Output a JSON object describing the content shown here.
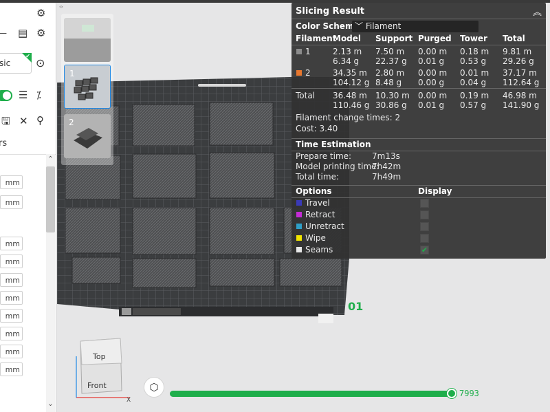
{
  "sidebar": {
    "combo_value": "sic",
    "label": "rs",
    "unit": "mm",
    "unit_rows": 10
  },
  "viewport": {
    "plates": [
      {
        "number": ""
      },
      {
        "number": "1"
      },
      {
        "number": "2"
      }
    ],
    "object_label": "01",
    "navcube": {
      "top": "Top",
      "front": "Front"
    },
    "slider": {
      "value": "7993",
      "progress": 1.0
    }
  },
  "slicing_result": {
    "title": "Slicing Result",
    "color_scheme_label": "Color Scheme",
    "color_scheme_value": "Filament",
    "headers": [
      "Filament",
      "Model",
      "Support",
      "Purged",
      "Tower",
      "Total"
    ],
    "filaments": [
      {
        "id": "1",
        "color": "#8c8c8c",
        "model": [
          "2.13 m",
          "6.34 g"
        ],
        "support": [
          "7.50 m",
          "22.37 g"
        ],
        "purged": [
          "0.00 m",
          "0.01 g"
        ],
        "tower": [
          "0.18 m",
          "0.53 g"
        ],
        "total": [
          "9.81 m",
          "29.26 g"
        ]
      },
      {
        "id": "2",
        "color": "#e8772e",
        "model": [
          "34.35 m",
          "104.12 g"
        ],
        "support": [
          "2.80 m",
          "8.48 g"
        ],
        "purged": [
          "0.00 m",
          "0.00 g"
        ],
        "tower": [
          "0.01 m",
          "0.04 g"
        ],
        "total": [
          "37.17 m",
          "112.64 g"
        ]
      }
    ],
    "total_row": {
      "label": "Total",
      "model": [
        "36.48 m",
        "110.46 g"
      ],
      "support": [
        "10.30 m",
        "30.86 g"
      ],
      "purged": [
        "0.00 m",
        "0.01 g"
      ],
      "tower": [
        "0.19 m",
        "0.57 g"
      ],
      "total": [
        "46.98 m",
        "141.90 g"
      ]
    },
    "filament_change": "Filament change times: 2",
    "cost": "Cost: 3.40",
    "time_title": "Time Estimation",
    "times": [
      {
        "label": "Prepare time:",
        "value": "7m13s"
      },
      {
        "label": "Model printing time:",
        "value": "7h42m"
      },
      {
        "label": "Total time:",
        "value": "7h49m"
      }
    ],
    "options_header": "Options",
    "display_header": "Display",
    "options": [
      {
        "label": "Travel",
        "color": "#3a3ab8",
        "checked": false
      },
      {
        "label": "Retract",
        "color": "#c42bd6",
        "checked": false
      },
      {
        "label": "Unretract",
        "color": "#2e9fc7",
        "checked": false
      },
      {
        "label": "Wipe",
        "color": "#f2e600",
        "checked": false
      },
      {
        "label": "Seams",
        "color": "#e8e8e8",
        "checked": true
      }
    ]
  },
  "colors": {
    "accent": "#1fae4b",
    "panel_bg": "#323232"
  }
}
